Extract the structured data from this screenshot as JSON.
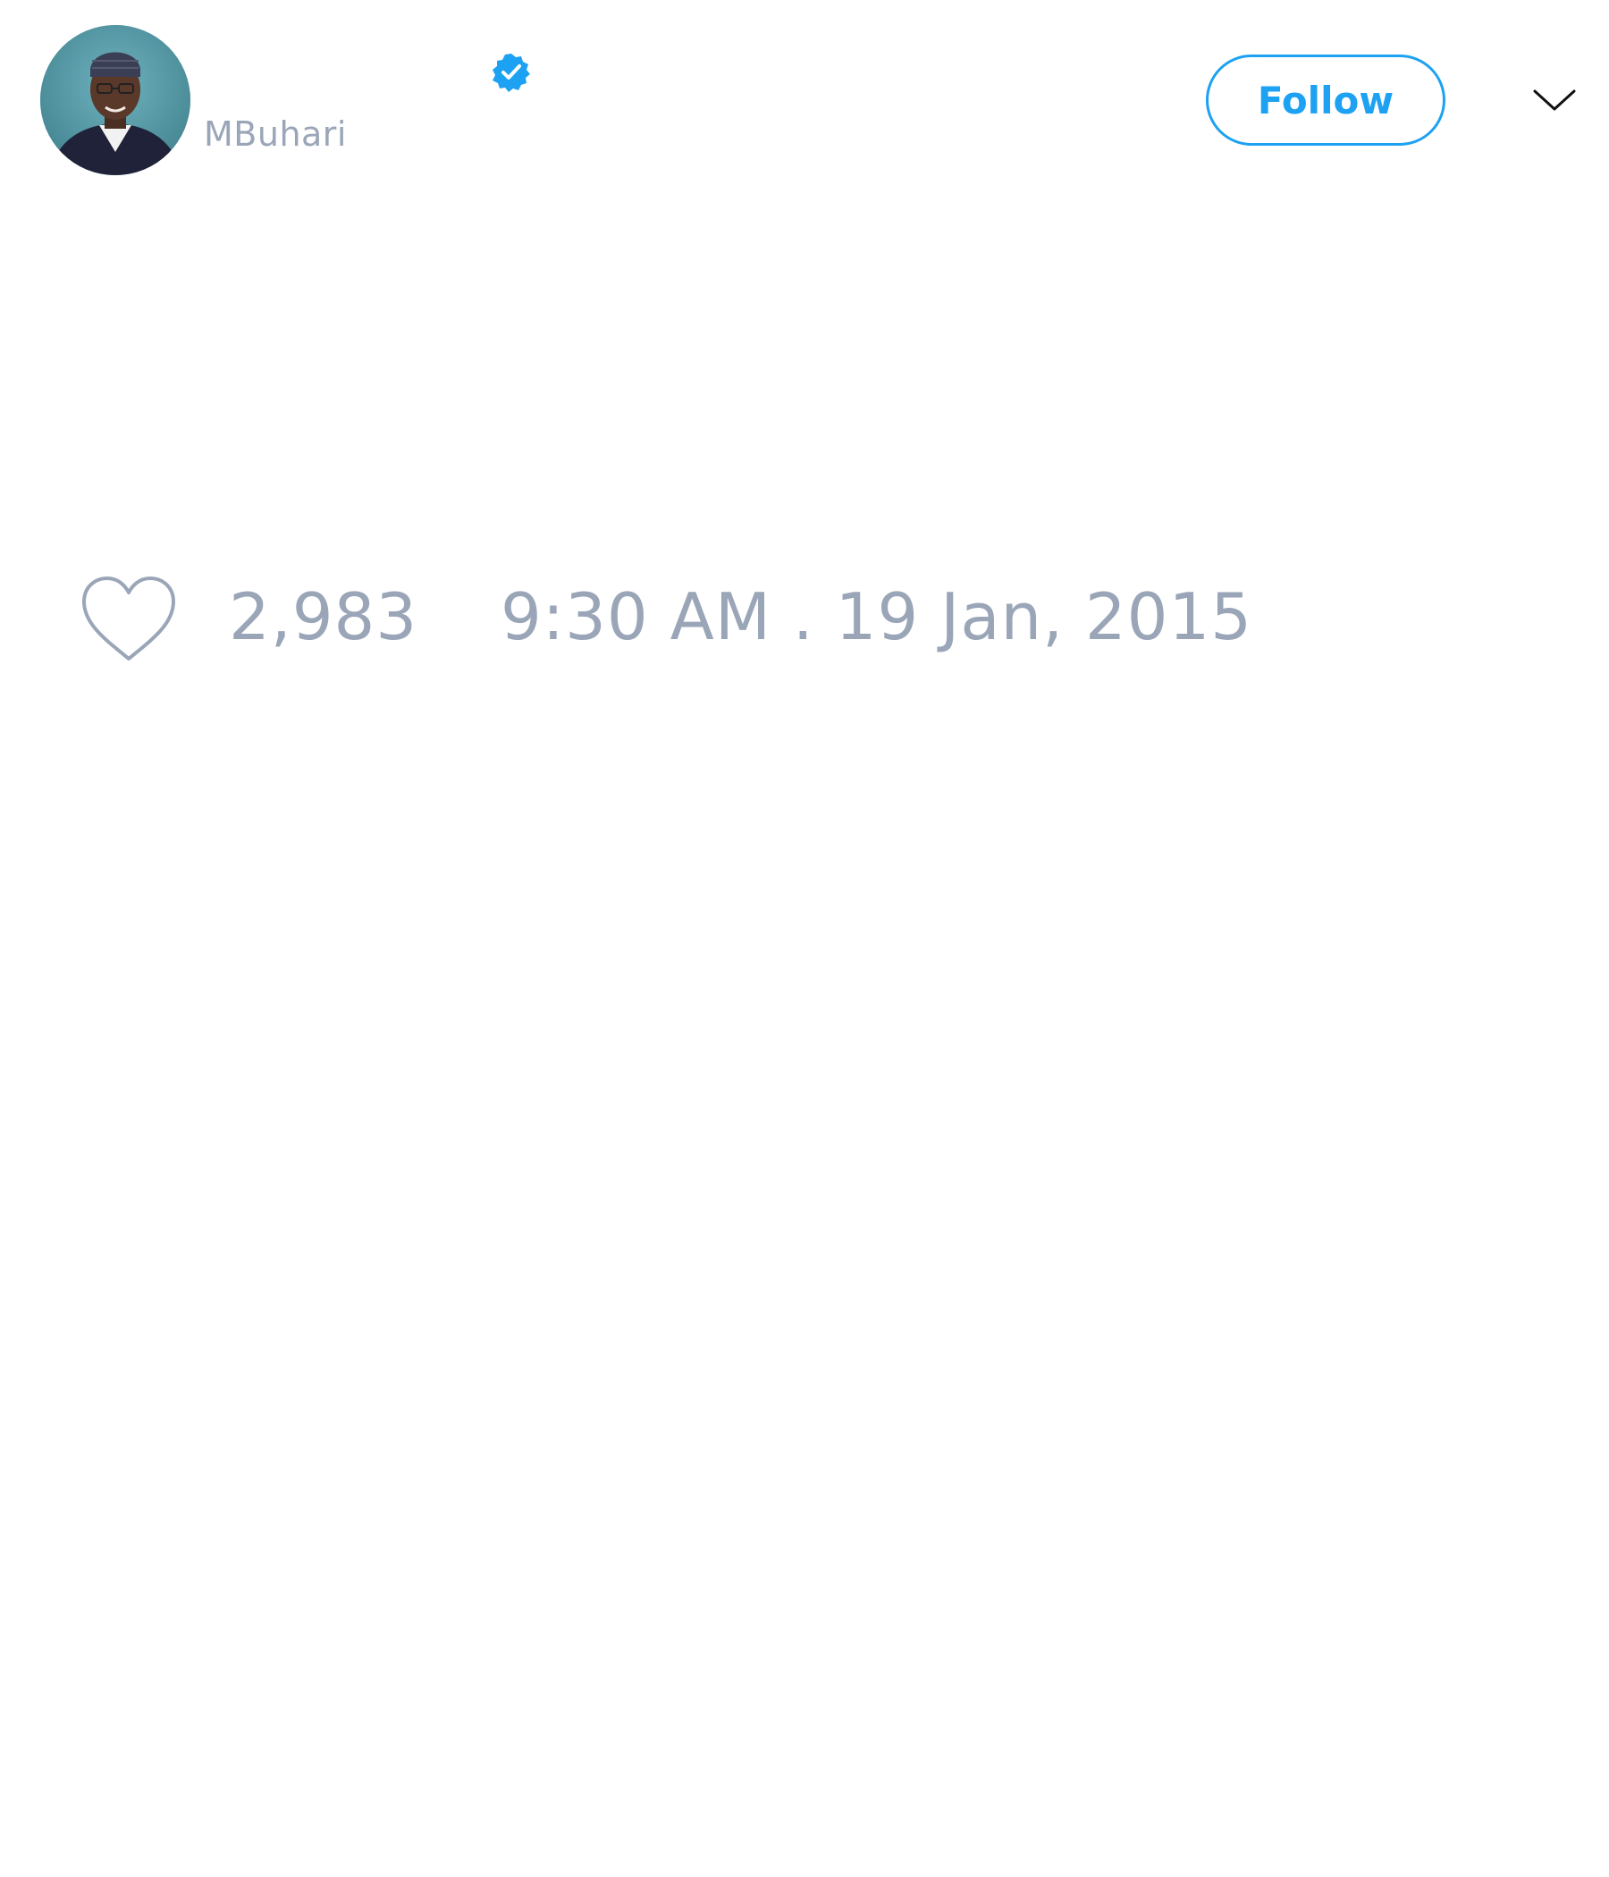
{
  "header": {
    "handle": "MBuhari",
    "follow_label": "Follow"
  },
  "tweet": {
    "like_count": "2,983",
    "timestamp": "9:30 AM . 19 Jan, 2015"
  },
  "icons": {
    "verified": "verified-badge-icon",
    "more": "chevron-down-icon",
    "like": "heart-outline-icon",
    "avatar": "profile-avatar"
  },
  "colors": {
    "accent": "#1da1f2",
    "muted_text": "#9aa6b8",
    "background": "#ffffff"
  }
}
